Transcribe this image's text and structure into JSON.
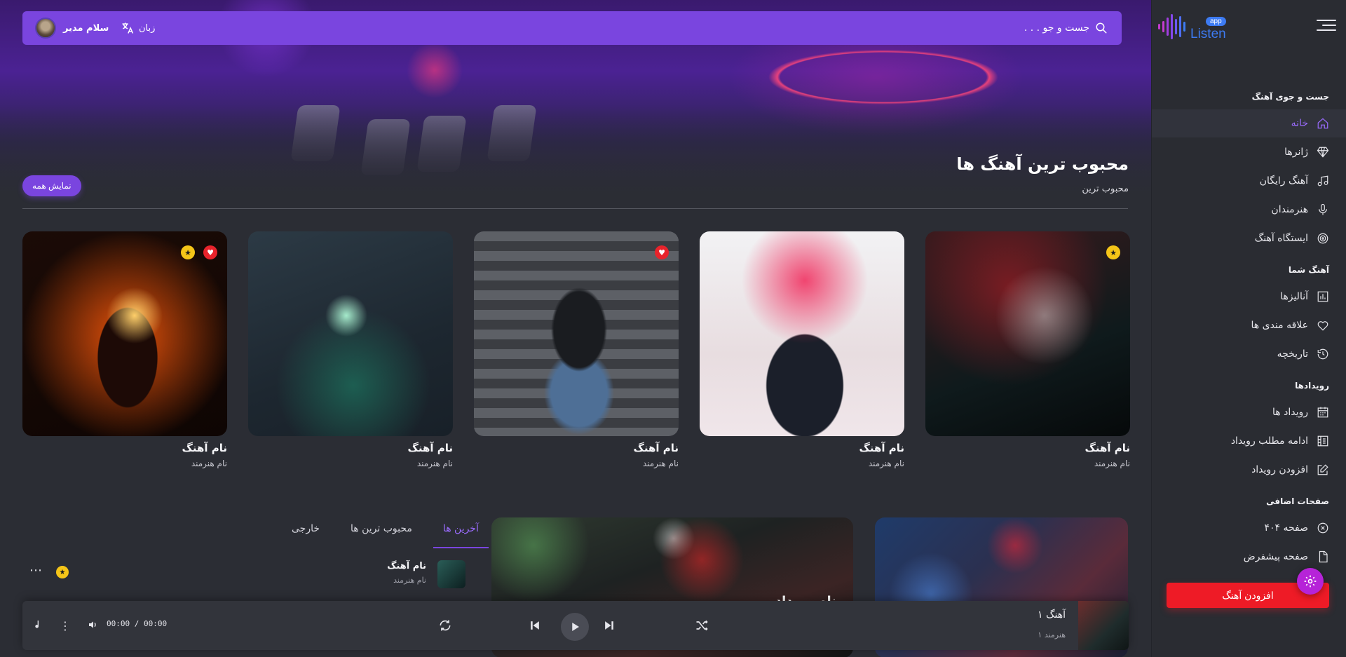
{
  "brand": {
    "name": "Listen",
    "badge": "app"
  },
  "topbar": {
    "search_placeholder": "جست و جو . . .",
    "language_label": "زبان",
    "user_name": "سلام مدیر"
  },
  "sidebar": {
    "sections": [
      {
        "title": "جست و جوی آهنگ",
        "items": [
          {
            "label": "خانه",
            "icon": "home-icon",
            "active": true
          },
          {
            "label": "ژانرها",
            "icon": "diamond-icon"
          },
          {
            "label": "آهنگ رایگان",
            "icon": "music-note-icon"
          },
          {
            "label": "هنرمندان",
            "icon": "microphone-icon"
          },
          {
            "label": "ایستگاه آهنگ",
            "icon": "radio-icon"
          }
        ]
      },
      {
        "title": "آهنگ شما",
        "items": [
          {
            "label": "آنالیزها",
            "icon": "bar-chart-icon"
          },
          {
            "label": "علاقه مندی ها",
            "icon": "heart-icon"
          },
          {
            "label": "تاریخچه",
            "icon": "history-icon"
          }
        ]
      },
      {
        "title": "رویدادها",
        "items": [
          {
            "label": "رویداد ها",
            "icon": "calendar-icon"
          },
          {
            "label": "ادامه مطلب رویداد",
            "icon": "building-icon"
          },
          {
            "label": "افزودن رویداد",
            "icon": "edit-icon"
          }
        ]
      },
      {
        "title": "صفحات اضافی",
        "items": [
          {
            "label": "صفحه ۴۰۴",
            "icon": "x-circle-icon"
          },
          {
            "label": "صفحه پیشفرض",
            "icon": "file-icon"
          }
        ]
      }
    ],
    "add_song_label": "افزودن آهنگ"
  },
  "popular": {
    "title": "محبوب ترین آهنگ ها",
    "subtitle": "محبوب ترین",
    "show_all_label": "نمایش همه",
    "cards": [
      {
        "title": "نام آهنگ",
        "artist": "نام هنرمند",
        "star": true,
        "heart": false
      },
      {
        "title": "نام آهنگ",
        "artist": "نام هنرمند",
        "star": false,
        "heart": false
      },
      {
        "title": "نام آهنگ",
        "artist": "نام هنرمند",
        "star": false,
        "heart": true
      },
      {
        "title": "نام آهنگ",
        "artist": "نام هنرمند",
        "star": false,
        "heart": false
      },
      {
        "title": "نام آهنگ",
        "artist": "نام هنرمند",
        "star": true,
        "heart": true
      }
    ]
  },
  "tabs": [
    "آخرین ها",
    "محبوب ترین ها",
    "خارجی"
  ],
  "active_tab": 0,
  "song_list": [
    {
      "title": "نام آهنگ",
      "artist": "نام هنرمند"
    }
  ],
  "events": [
    {
      "name": "نام رویداد"
    }
  ],
  "player": {
    "track_title": "آهنگ ۱",
    "track_artist": "هنرمند ۱",
    "time": "00:00 / 00:00"
  },
  "colors": {
    "accent": "#7a45df",
    "sidebar_bg": "#2a2c32",
    "page_bg": "#2b2d34",
    "danger": "#ee1b26",
    "star": "#f5c518",
    "heart": "#e8232b"
  }
}
